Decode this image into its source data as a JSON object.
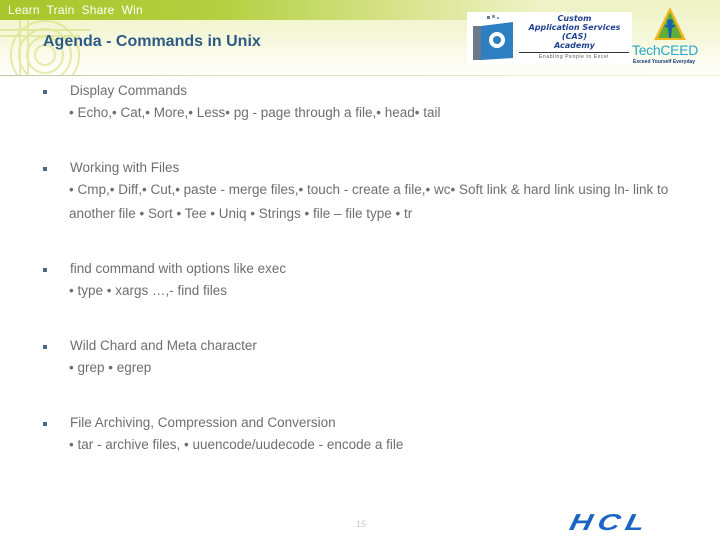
{
  "header": {
    "tagline": "Learn  Train  Share  Win",
    "title": "Agenda - Commands in Unix",
    "logos": {
      "cas": {
        "line1": "Custom",
        "line2": "Application Services",
        "line3": "(CAS)",
        "line4": "Academy",
        "subtitle": "Enabling People to Excel"
      },
      "techceed": {
        "name": "TechCEED",
        "tagline": "Exceed Yourself Everyday"
      }
    }
  },
  "items": [
    {
      "title": "Display Commands",
      "detail": "• Echo,• Cat,• More,• Less• pg - page through a file,• head• tail"
    },
    {
      "title": "Working with Files",
      "detail": "• Cmp,• Diff,• Cut,• paste - merge files,• touch - create a file,• wc• Soft link & hard link using ln- link to another file • Sort • Tee • Uniq • Strings • file – file type • tr"
    },
    {
      "title": "find command with options like exec",
      "detail": "• type • xargs  …,- find files"
    },
    {
      "title": "Wild Chard and Meta character",
      "detail": "• grep • egrep"
    },
    {
      "title": "File Archiving, Compression and Conversion",
      "detail": "• tar - archive files, • uuencode/uudecode - encode a file"
    }
  ],
  "footer": {
    "page_number": "15",
    "brand": "HCL"
  },
  "colors": {
    "title": "#2e5a86",
    "band": "#a7c62a",
    "body_text": "#6e6e6e",
    "bullet": "#4a6a8a",
    "brand": "#1a64c4"
  }
}
